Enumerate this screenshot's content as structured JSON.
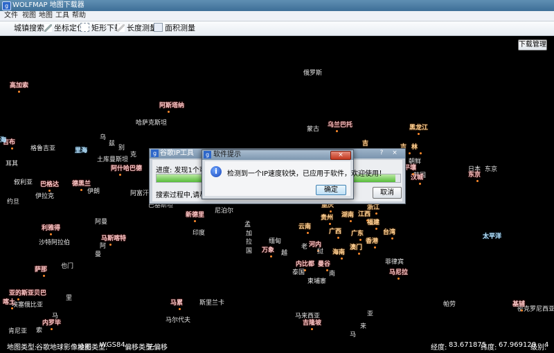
{
  "window": {
    "title": "WOLFMAP 地图下载器",
    "icon": "app-logo-icon"
  },
  "menu": [
    "文件",
    "视图",
    "地图",
    "工具",
    "帮助"
  ],
  "toolbar": {
    "city_search": "城镇搜索",
    "coord_locate": "坐标定位",
    "rect_download": "矩形下载",
    "length_measure": "长度测量",
    "area_measure": "面积测量"
  },
  "download_manager": "下载管理",
  "labels": [
    {
      "t": "俄罗斯",
      "c": "w"
    },
    {
      "t": "哈萨克斯坦",
      "c": "w"
    },
    {
      "t": "蒙古",
      "c": "w"
    },
    {
      "t": "高加索",
      "c": "p"
    },
    {
      "t": "阿斯塔纳",
      "c": "p"
    },
    {
      "t": "乌兰巴托",
      "c": "p"
    },
    {
      "t": "黑龙江",
      "c": "o"
    },
    {
      "t": "吉",
      "c": "o"
    },
    {
      "t": "林",
      "c": "o"
    },
    {
      "t": "吉",
      "c": "o"
    },
    {
      "t": "乌",
      "c": "w"
    },
    {
      "t": "兹",
      "c": "w"
    },
    {
      "t": "别",
      "c": "w"
    },
    {
      "t": "克",
      "c": "w"
    },
    {
      "t": "格鲁吉亚",
      "c": "w"
    },
    {
      "t": "里海",
      "c": "b"
    },
    {
      "t": "土库曼斯坦",
      "c": "w"
    },
    {
      "t": "阿什哈巴德",
      "c": "p"
    },
    {
      "t": "耳其",
      "c": "w"
    },
    {
      "t": "叙利亚",
      "c": "w"
    },
    {
      "t": "巴格达",
      "c": "p"
    },
    {
      "t": "德黑兰",
      "c": "p"
    },
    {
      "t": "伊拉克",
      "c": "w"
    },
    {
      "t": "伊朗",
      "c": "w"
    },
    {
      "t": "阿富汗",
      "c": "w"
    },
    {
      "t": "约旦",
      "c": "w"
    },
    {
      "t": "巴基斯坦",
      "c": "w"
    },
    {
      "t": "朝鲜",
      "c": "w"
    },
    {
      "t": "日本",
      "c": "w"
    },
    {
      "t": "韩国",
      "c": "w"
    },
    {
      "t": "东京",
      "c": "p"
    },
    {
      "t": "新德里",
      "c": "p"
    },
    {
      "t": "尼泊尔",
      "c": "w"
    },
    {
      "t": "印度",
      "c": "w"
    },
    {
      "t": "孟",
      "c": "w"
    },
    {
      "t": "加",
      "c": "w"
    },
    {
      "t": "拉",
      "c": "w"
    },
    {
      "t": "国",
      "c": "w"
    },
    {
      "t": "缅甸",
      "c": "w"
    },
    {
      "t": "阿曼",
      "c": "w"
    },
    {
      "t": "利雅得",
      "c": "p"
    },
    {
      "t": "马斯喀特",
      "c": "p"
    },
    {
      "t": "沙特阿拉伯",
      "c": "w"
    },
    {
      "t": "阿",
      "c": "w"
    },
    {
      "t": "曼",
      "c": "w"
    },
    {
      "t": "也门",
      "c": "w"
    },
    {
      "t": "萨那",
      "c": "p"
    },
    {
      "t": "太平洋",
      "c": "b"
    },
    {
      "t": "重庆",
      "c": "o"
    },
    {
      "t": "湖南",
      "c": "o"
    },
    {
      "t": "江西",
      "c": "o"
    },
    {
      "t": "浙江",
      "c": "o"
    },
    {
      "t": "福建",
      "c": "o"
    },
    {
      "t": "台湾",
      "c": "o"
    },
    {
      "t": "贵州",
      "c": "o"
    },
    {
      "t": "云南",
      "c": "o"
    },
    {
      "t": "广西",
      "c": "o"
    },
    {
      "t": "广东",
      "c": "o"
    },
    {
      "t": "香港",
      "c": "o"
    },
    {
      "t": "澳门",
      "c": "o"
    },
    {
      "t": "海南",
      "c": "o"
    },
    {
      "t": "河内",
      "c": "p"
    },
    {
      "t": "老",
      "c": "w"
    },
    {
      "t": "挝",
      "c": "w"
    },
    {
      "t": "越",
      "c": "w"
    },
    {
      "t": "万象",
      "c": "p"
    },
    {
      "t": "内比都",
      "c": "p"
    },
    {
      "t": "泰国",
      "c": "w"
    },
    {
      "t": "曼谷",
      "c": "p"
    },
    {
      "t": "柬埔寨",
      "c": "w"
    },
    {
      "t": "南",
      "c": "w"
    },
    {
      "t": "菲律宾",
      "c": "w"
    },
    {
      "t": "马尼拉",
      "c": "p"
    },
    {
      "t": "亚的斯亚贝巴",
      "c": "p"
    },
    {
      "t": "埃塞俄比亚",
      "c": "w"
    },
    {
      "t": "里",
      "c": "w"
    },
    {
      "t": "马累",
      "c": "p"
    },
    {
      "t": "斯里兰卡",
      "c": "w"
    },
    {
      "t": "马尔代夫",
      "c": "w"
    },
    {
      "t": "马来西亚",
      "c": "w"
    },
    {
      "t": "吉隆坡",
      "c": "p"
    },
    {
      "t": "亚",
      "c": "w"
    },
    {
      "t": "来",
      "c": "w"
    },
    {
      "t": "马",
      "c": "w"
    },
    {
      "t": "帕劳",
      "c": "w"
    },
    {
      "t": "密克罗尼西亚联",
      "c": "w"
    },
    {
      "t": "肯尼亚",
      "c": "w"
    },
    {
      "t": "索",
      "c": "w"
    },
    {
      "t": "内罗毕",
      "c": "p"
    },
    {
      "t": "马",
      "c": "w"
    },
    {
      "t": "喀土",
      "c": "p"
    },
    {
      "t": "吉布",
      "c": "p"
    },
    {
      "t": "海",
      "c": "b"
    },
    {
      "t": "基辅",
      "c": "p"
    },
    {
      "t": "汉城",
      "c": "p"
    },
    {
      "t": "平壤",
      "c": "p"
    },
    {
      "t": "东京",
      "c": "w"
    }
  ],
  "back_dialog": {
    "title": "谷歌IP工具",
    "progress_text": "进度: 发现1个可用IP",
    "progress": 0.98,
    "status": "搜索过程中,请尽量暂",
    "cancel": "取消",
    "help": "?",
    "close": "×"
  },
  "front_dialog": {
    "title": "软件提示",
    "message": "检测到一个IP速度较快，已应用于软件，欢迎使用！",
    "ok": "确定",
    "close": "×"
  },
  "status": {
    "map_type_label": "地图类型:",
    "map_type": "谷歌地球影像地图",
    "projection_label": "投影类型:",
    "projection": "WGS84",
    "offset_label": "偏移类型:",
    "offset": "无偏移",
    "lon_label": "经度:",
    "lon": "83.671875",
    "lat_label": "纬度:",
    "lat": "67.969128",
    "level_label": "级别:",
    "level": "4"
  }
}
